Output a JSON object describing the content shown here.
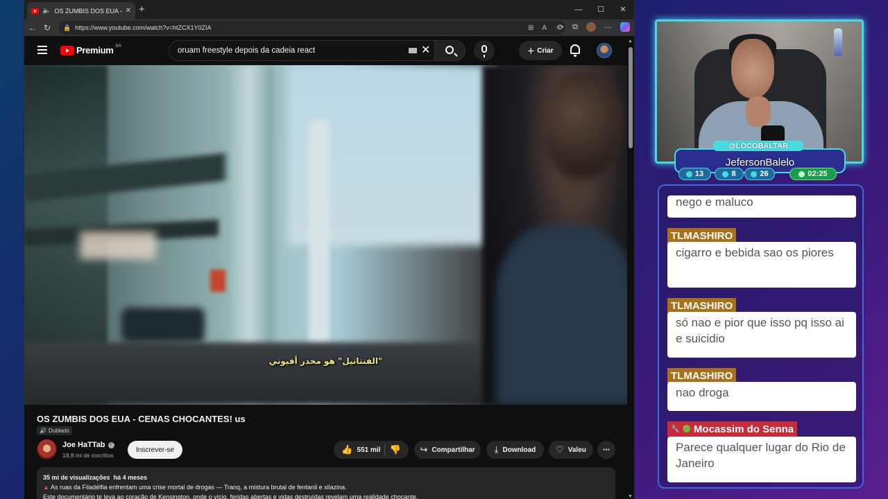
{
  "browser": {
    "tab_title": "OS ZUMBIS DOS EUA - CENA",
    "url": "https://www.youtube.com/watch?v=htZCX1Y0ZIA"
  },
  "youtube": {
    "logo_text": "Premium",
    "logo_region": "BR",
    "search_value": "oruam freestyle depois da cadeia react",
    "create_label": "Criar"
  },
  "video": {
    "subtitle": "\"الفنتانيل\" هو مخدر أفيوني",
    "title": "OS ZUMBIS DOS EUA - CENAS CHOCANTES! us",
    "dubbed_label": "Dublado",
    "channel_name": "Joe HaTTab",
    "subscribers": "18,8 mi de inscritos",
    "subscribe_label": "Inscrever-se",
    "likes": "551 mil",
    "share_label": "Compartilhar",
    "download_label": "Download",
    "thanks_label": "Valeu",
    "views": "35 mi de visualizações",
    "age": "há 4 meses",
    "desc_line1": "As ruas da Filadélfia enfrentam uma crise mortal de drogas — Tranq, a mistura brutal de fentanil e xilazina.",
    "desc_line2": "Este documentário te leva ao coração de Kensington, onde o vício, feridas abertas e vidas destruídas revelam uma realidade chocante."
  },
  "stream": {
    "handle": "@LOCOBALTAR",
    "streamer_name": "JefersonBalelo",
    "stats": {
      "stat1": "13",
      "stat2": "8",
      "stat3": "26",
      "timer": "02:25"
    }
  },
  "chat": {
    "messages": [
      {
        "user": "",
        "text": "nego e maluco"
      },
      {
        "user": "TLMASHIRO",
        "text": "cigarro e bebida sao os piores"
      },
      {
        "user": "TLMASHIRO",
        "text": "só nao e pior que isso pq isso ai e suicidio"
      },
      {
        "user": "TLMASHIRO",
        "text": "nao droga"
      },
      {
        "user": "Mocassim do Senna",
        "text": "Parece qualquer lugar do Rio de Janeiro"
      }
    ]
  },
  "colors": {
    "accent_cyan": "#49d9e0",
    "tag_gold": "#a87019",
    "tag_red": "#c92a37",
    "yt_red": "#ff0000"
  }
}
